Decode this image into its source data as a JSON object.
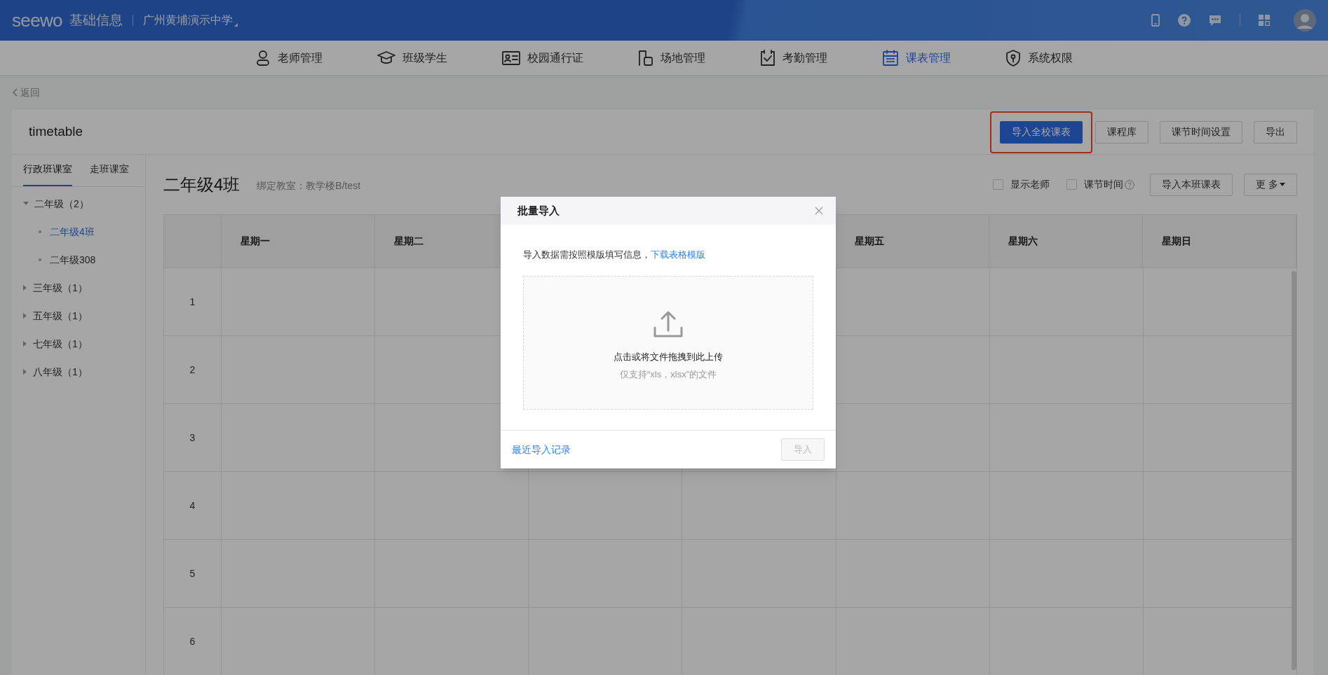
{
  "header": {
    "logo": "seewo",
    "app_title": "基础信息",
    "school": "广州黄埔演示中学"
  },
  "nav": [
    {
      "label": "老师管理",
      "selected": false
    },
    {
      "label": "班级学生",
      "selected": false
    },
    {
      "label": "校园通行证",
      "selected": false
    },
    {
      "label": "场地管理",
      "selected": false
    },
    {
      "label": "考勤管理",
      "selected": false
    },
    {
      "label": "课表管理",
      "selected": true
    },
    {
      "label": "系统权限",
      "selected": false
    }
  ],
  "back_link": "返回",
  "page": {
    "title": "timetable",
    "actions": [
      {
        "label": "导入全校课表",
        "kind": "primary",
        "highlighted": true
      },
      {
        "label": "课程库",
        "kind": "default",
        "highlighted": false
      },
      {
        "label": "课节时间设置",
        "kind": "default",
        "highlighted": false
      },
      {
        "label": "导出",
        "kind": "default",
        "highlighted": false
      }
    ]
  },
  "sidebar": {
    "tabs": [
      {
        "label": "行政班课室",
        "selected": true
      },
      {
        "label": "走班课室",
        "selected": false
      }
    ],
    "tree": [
      {
        "label": "二年级（2）",
        "expanded": true,
        "children": [
          {
            "label": "二年级4班",
            "selected": true
          },
          {
            "label": "二年级308",
            "selected": false
          }
        ]
      },
      {
        "label": "三年级（1）",
        "expanded": false
      },
      {
        "label": "五年级（1）",
        "expanded": false
      },
      {
        "label": "七年级（1）",
        "expanded": false
      },
      {
        "label": "八年级（1）",
        "expanded": false
      }
    ]
  },
  "class_view": {
    "title": "二年级4班",
    "classroom": "绑定教室：教学楼B/test",
    "options": [
      {
        "label": "显示老师",
        "checked": false,
        "help": false
      },
      {
        "label": "课节时间",
        "checked": false,
        "help": true
      }
    ],
    "buttons": [
      {
        "label": "导入本班课表",
        "kind": "default"
      },
      {
        "label": "更 多",
        "kind": "dropdown"
      }
    ]
  },
  "timetable": {
    "columns": [
      {
        "label": "星期一"
      },
      {
        "label": "星期二"
      },
      {},
      {},
      {
        "label": "星期五"
      },
      {
        "label": "星期六"
      },
      {
        "label": "星期日"
      }
    ],
    "rows": [
      "1",
      "2",
      "3",
      "4",
      "5",
      "6"
    ]
  },
  "dialog": {
    "title": "批量导入",
    "instruction": "导入数据需按照模版填写信息，",
    "template_link": "下载表格模版",
    "upload_text": "点击或将文件拖拽到此上传",
    "upload_hint": "仅支持“xls，xlsx”的文件",
    "history_link": "最近导入记录",
    "submit": {
      "label": "导入",
      "disabled": true
    }
  }
}
